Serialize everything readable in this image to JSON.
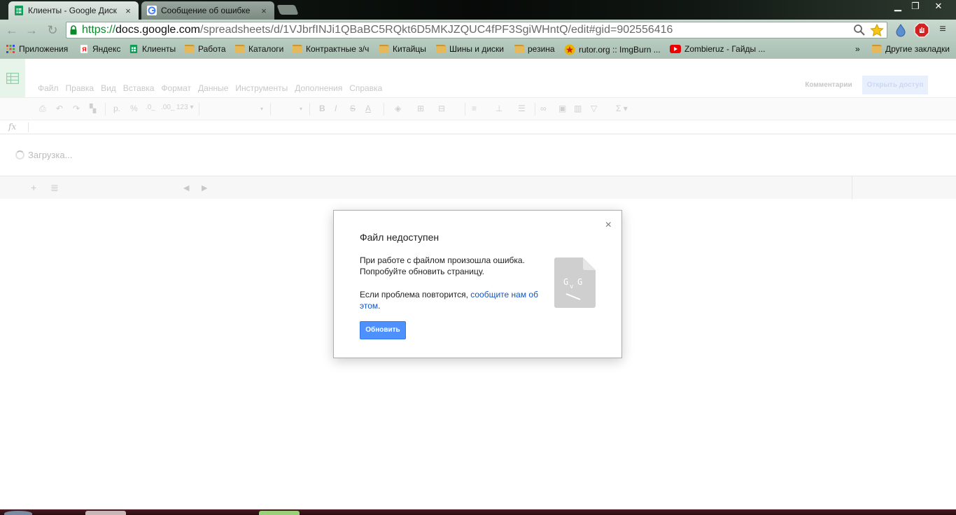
{
  "browser": {
    "tabs": [
      {
        "title": "Клиенты - Google Диск",
        "active": true
      },
      {
        "title": "Сообщение об ошибке",
        "active": false
      }
    ],
    "tab_close_glyph": "×",
    "window_buttons": {
      "minimize": "▁",
      "restore": "❐",
      "close": "✕"
    },
    "address": {
      "scheme": "https://",
      "host": "docs.google.com",
      "path": "/spreadsheets/d/1VJbrfINJi1QBaBC5RQkt6D5MKJZQUC4fPF3SgiWHntQ/edit#gid=902556416"
    },
    "bookmarks": [
      {
        "label": "Приложения",
        "icon": "apps-icon"
      },
      {
        "label": "Яндекс",
        "icon": "yandex-icon"
      },
      {
        "label": "Клиенты",
        "icon": "sheets-icon"
      },
      {
        "label": "Работа",
        "icon": "folder-icon"
      },
      {
        "label": "Каталоги",
        "icon": "folder-icon"
      },
      {
        "label": "Контрактные з/ч",
        "icon": "folder-icon"
      },
      {
        "label": "Китайцы",
        "icon": "folder-icon"
      },
      {
        "label": "Шины и диски",
        "icon": "folder-icon"
      },
      {
        "label": "резина",
        "icon": "folder-icon"
      },
      {
        "label": "rutor.org :: ImgBurn ...",
        "icon": "rutor-icon"
      },
      {
        "label": "Zombieruz - Гайды ...",
        "icon": "youtube-icon"
      }
    ],
    "bookmarks_overflow": "»",
    "other_bookmarks": "Другие закладки"
  },
  "sheets": {
    "menu": [
      "Файл",
      "Правка",
      "Вид",
      "Вставка",
      "Формат",
      "Данные",
      "Инструменты",
      "Дополнения",
      "Справка"
    ],
    "comments_label": "Комментарии",
    "share_label": "Открыть доступ",
    "toolbar": {
      "currency": "р.",
      "percent": "%",
      "dec_less": ".0_",
      "dec_more": ".00_",
      "more_formats": "123 ▾",
      "sigma": "Σ ▾",
      "bold": "B",
      "italic": "I",
      "strike": "S",
      "text_color": "A"
    },
    "fx_label": "fx",
    "loading_text": "Загрузка..."
  },
  "dialog": {
    "title": "Файл недоступен",
    "line1": "При работе с файлом произошла ошибка. Попробуйте обновить страницу.",
    "line2_prefix": "Если проблема повторится, ",
    "line2_link": "сообщите нам об этом",
    "line2_suffix": ".",
    "button": "Обновить",
    "close_glyph": "×"
  },
  "colors": {
    "accent_blue": "#4d90fe",
    "link": "#1155cc",
    "sheets_green": "#0f9d58"
  }
}
